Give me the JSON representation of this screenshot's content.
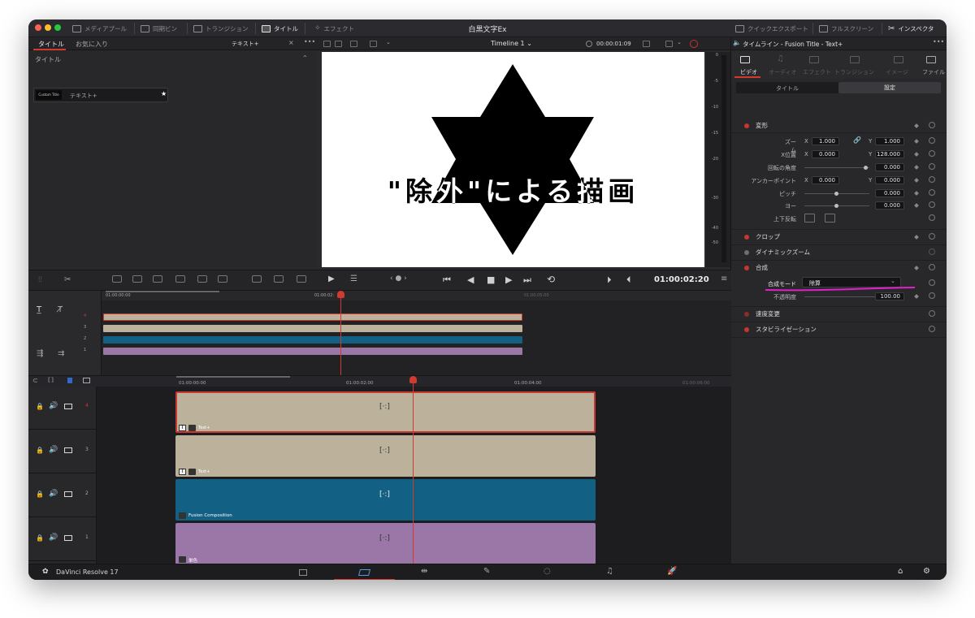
{
  "title_bar": {
    "items": [
      {
        "label": "メディアプール"
      },
      {
        "label": "同期ビン"
      },
      {
        "label": "トランジション"
      },
      {
        "label": "タイトル"
      },
      {
        "label": "エフェクト"
      }
    ],
    "center_title": "白黒文字Ex",
    "right_items": [
      {
        "label": "クイックエクスポート"
      },
      {
        "label": "フルスクリーン"
      },
      {
        "label": "インスペクタ"
      }
    ]
  },
  "library": {
    "tabs": [
      "タイトル",
      "お気に入り"
    ],
    "filter_text": "テキスト+",
    "section": "タイトル",
    "item_badge": "Custom Title",
    "item_label": "テキスト+"
  },
  "viewer": {
    "timeline_name": "Timeline 1",
    "timecode_top": "00:00:01:09",
    "overlay_text": "\"除外\"による描画",
    "timecode": "01:00:02:20",
    "meter_ticks": [
      "0",
      "-5",
      "-10",
      "-15",
      "-20",
      "-30",
      "-40",
      "-50"
    ]
  },
  "inspector": {
    "header": "タイムライン - Fusion Title - Text+",
    "tabs": [
      "ビデオ",
      "オーディオ",
      "エフェクト",
      "トランジション",
      "イメージ",
      "ファイル"
    ],
    "subtabs": [
      "タイトル",
      "設定"
    ],
    "transform": {
      "title": "変形",
      "zoom_label": "ズーム",
      "zoom_x": "1.000",
      "zoom_y": "1.000",
      "pos_label": "X位置",
      "pos_x": "0.000",
      "pos_y": "128.000",
      "rot_label": "回転の角度",
      "rot": "0.000",
      "anchor_label": "アンカーポイント",
      "anchor_x": "0.000",
      "anchor_y": "0.000",
      "pitch_label": "ピッチ",
      "pitch": "0.000",
      "yaw_label": "ヨー",
      "yaw": "0.000",
      "flip_label": "上下反転",
      "x": "X",
      "y": "Y"
    },
    "crop": "クロップ",
    "dynamic_zoom": "ダイナミックズーム",
    "composite": {
      "title": "合成",
      "mode_label": "合成モード",
      "mode_value": "除算",
      "opacity_label": "不透明度",
      "opacity": "100.00"
    },
    "speed": "速度変更",
    "stabilization": "スタビライゼーション"
  },
  "mini_timeline": {
    "times": [
      "01:00:00:00",
      "01:00:02:",
      "01:00:05:00"
    ],
    "tracks": [
      "4",
      "3",
      "2",
      "1"
    ]
  },
  "timeline": {
    "times": [
      "01:00:00:00",
      "01:00:02:00",
      "01:00:04:00",
      "01:00:06:00"
    ],
    "tracks": [
      {
        "num": "4",
        "clip_label": "Text+",
        "color": "#bcb29b"
      },
      {
        "num": "3",
        "clip_label": "Text+",
        "color": "#bcb29b"
      },
      {
        "num": "2",
        "clip_label": "Fusion Composition",
        "color": "#126185"
      },
      {
        "num": "1",
        "clip_label": "単色",
        "color": "#9a77a6"
      }
    ]
  },
  "bottom_bar": {
    "app_name": "DaVinci Resolve 17",
    "pages": [
      "media",
      "cut",
      "edit",
      "fusion",
      "color",
      "fairlight",
      "deliver"
    ],
    "active_page": "cut"
  },
  "colors": {
    "accent_red": "#d03a31",
    "annotation": "#e020c8"
  }
}
